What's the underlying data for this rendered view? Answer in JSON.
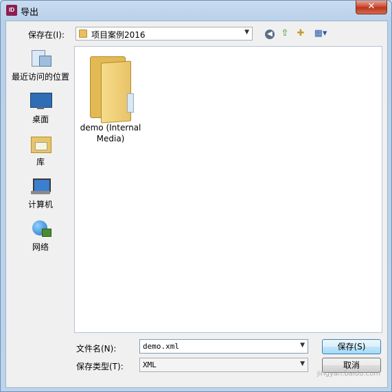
{
  "window": {
    "title": "导出",
    "app_icon_text": "ID",
    "close_glyph": "✕"
  },
  "toolbar": {
    "save_in_label": "保存在(I):",
    "location": "项目案例2016",
    "back_glyph": "◀",
    "up_glyph": "⇧",
    "new_folder_glyph": "✚",
    "view_glyph": "▦▾"
  },
  "places": [
    {
      "label": "最近访问的位置",
      "icon": "recent-places-icon"
    },
    {
      "label": "桌面",
      "icon": "desktop-icon"
    },
    {
      "label": "库",
      "icon": "library-icon"
    },
    {
      "label": "计算机",
      "icon": "computer-icon"
    },
    {
      "label": "网络",
      "icon": "network-icon"
    }
  ],
  "files": [
    {
      "name": "demo (Internal Media)",
      "type": "folder"
    }
  ],
  "footer": {
    "filename_label": "文件名(N):",
    "filename_value": "demo.xml",
    "filetype_label": "保存类型(T):",
    "filetype_value": "XML",
    "save_button": "保存(S)",
    "cancel_button": "取消"
  },
  "watermark": "jingyan.baidu.com"
}
